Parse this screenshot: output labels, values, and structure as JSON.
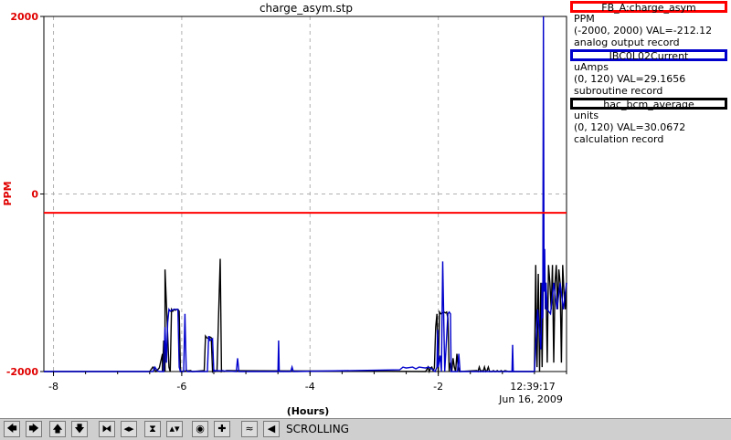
{
  "chart_data": {
    "type": "line",
    "title": "charge_asym.stp",
    "xlabel": "(Hours)",
    "ylabel": "PPM",
    "xlim": [
      -8.15,
      0
    ],
    "ylim": [
      -2000,
      2000
    ],
    "x_ticks": [
      -8,
      -6,
      -4,
      -2
    ],
    "x_tick_labels": [
      "-8",
      "-6",
      "-4",
      "-2"
    ],
    "y_ticks": [
      2000,
      0,
      -2000
    ],
    "y_tick_labels": [
      "2000",
      "0",
      "-2000"
    ],
    "end_time": "12:39:17",
    "end_date": "Jun 16, 2009",
    "grid": true,
    "series": [
      {
        "color": "#000000",
        "x": [
          -8.15,
          -6.5,
          -6.45,
          -6.4,
          -6.35,
          -6.3,
          -6.3,
          -6.28,
          -6.26,
          -6.26,
          -6.2,
          -6.18,
          -6.16,
          -6.14,
          -6.12,
          -6.1,
          -6.08,
          -6.06,
          -6.04,
          -6.02,
          -5.86,
          -5.84,
          -5.82,
          -5.65,
          -5.63,
          -5.61,
          -5.58,
          -5.56,
          -5.54,
          -5.52,
          -5.5,
          -5.48,
          -5.45,
          -5.4,
          -5.38,
          -5.36,
          -5.34,
          -5.3,
          -2.2,
          -2.18,
          -2.16,
          -2.14,
          -2.12,
          -2.1,
          -2.08,
          -2.06,
          -2.04,
          -2.02,
          -2.0,
          -1.98,
          -1.96,
          -1.93,
          -1.91,
          -1.89,
          -1.87,
          -1.85,
          -1.83,
          -1.81,
          -1.79,
          -1.77,
          -1.75,
          -1.73,
          -1.71,
          -1.69,
          -1.67,
          -1.4,
          -1.38,
          -1.36,
          -1.34,
          -1.32,
          -1.3,
          -1.28,
          -1.26,
          -1.24,
          -1.22,
          -1.2,
          -1.18,
          -1.16,
          -1.14,
          -1.12,
          -1.1,
          -1.08,
          -1.06,
          -1.04,
          -1.02,
          -1.0,
          -0.98,
          -0.96,
          -0.9,
          -0.5,
          -0.48,
          -0.46,
          -0.44,
          -0.42,
          -0.4,
          -0.38,
          -0.36,
          -0.34,
          -0.32,
          -0.3,
          -0.28,
          -0.26,
          -0.24,
          -0.22,
          -0.2,
          -0.18,
          -0.16,
          -0.14,
          -0.12,
          -0.1,
          -0.08,
          -0.06,
          -0.04,
          -0.02,
          0.0
        ],
        "y": [
          -2000,
          -2000,
          -1950,
          -2000,
          -1960,
          -1800,
          -2000,
          -1650,
          -2000,
          -850,
          -1950,
          -2000,
          -1300,
          -1320,
          -1300,
          -1310,
          -1300,
          -1300,
          -1320,
          -2000,
          -1990,
          -2000,
          -2000,
          -1990,
          -1600,
          -1620,
          -1630,
          -1610,
          -1620,
          -2000,
          -1980,
          -2000,
          -1990,
          -730,
          -2000,
          -1990,
          -2000,
          -1990,
          -2000,
          -1980,
          -1950,
          -2000,
          -1960,
          -1950,
          -1990,
          -1960,
          -1500,
          -1350,
          -2000,
          -1330,
          -1350,
          -1340,
          -1330,
          -1340,
          -1330,
          -1400,
          -2000,
          -1900,
          -2000,
          -1850,
          -1950,
          -2000,
          -1800,
          -1950,
          -2000,
          -1990,
          -2000,
          -1950,
          -2000,
          -1990,
          -2000,
          -1950,
          -2000,
          -1990,
          -1950,
          -2000,
          -2000,
          -2000,
          -1990,
          -2000,
          -2000,
          -1990,
          -2000,
          -2000,
          -1990,
          -2000,
          -2000,
          -1990,
          -2000,
          -2000,
          -800,
          -1950,
          -900,
          -2000,
          -1000,
          -1950,
          -800,
          -1100,
          -1000,
          -1900,
          -800,
          -1000,
          -1300,
          -800,
          -1900,
          -1000,
          -800,
          -1300,
          -850,
          -1000,
          -1900,
          -800,
          -1100,
          -1300,
          -1000
        ]
      },
      {
        "color": "#0000cc",
        "x": [
          -8.15,
          -6.45,
          -6.42,
          -6.38,
          -6.35,
          -6.28,
          -6.26,
          -6.24,
          -6.22,
          -6.2,
          -6.18,
          -6.16,
          -6.12,
          -6.06,
          -6.04,
          -6.02,
          -5.97,
          -5.95,
          -5.93,
          -5.91,
          -5.6,
          -5.58,
          -5.56,
          -5.52,
          -5.5,
          -5.48,
          -5.15,
          -5.13,
          -5.11,
          -4.5,
          -4.49,
          -4.48,
          -4.3,
          -4.28,
          -4.26,
          -2.6,
          -2.55,
          -2.5,
          -2.4,
          -2.35,
          -2.3,
          -2.2,
          -2.15,
          -2.1,
          -2.05,
          -2.02,
          -2.01,
          -2.0,
          -1.97,
          -1.95,
          -1.93,
          -1.9,
          -1.85,
          -1.83,
          -1.81,
          -1.8,
          -1.7,
          -1.68,
          -1.66,
          -0.85,
          -0.84,
          -0.83,
          -0.5,
          -0.45,
          -0.4,
          -0.38,
          -0.37,
          -0.36,
          -0.35,
          -0.34,
          -0.33,
          -0.32,
          -0.3,
          -0.25,
          -0.2,
          -0.15,
          -0.1,
          -0.05,
          0.0
        ],
        "y": [
          -2000,
          -2000,
          -1950,
          -1990,
          -2000,
          -2000,
          -1500,
          -1900,
          -1450,
          -1300,
          -1320,
          -1310,
          -1300,
          -1300,
          -1950,
          -2000,
          -2000,
          -1350,
          -1980,
          -2000,
          -2000,
          -1600,
          -1650,
          -1630,
          -2000,
          -1990,
          -2000,
          -1850,
          -2000,
          -2000,
          -1650,
          -2000,
          -2000,
          -1950,
          -2000,
          -1980,
          -1950,
          -1960,
          -1950,
          -1970,
          -1950,
          -1960,
          -1950,
          -1970,
          -2000,
          -1950,
          -1530,
          -1950,
          -1820,
          -2000,
          -760,
          -2000,
          -1350,
          -1330,
          -1350,
          -2000,
          -2000,
          -1800,
          -2000,
          -2000,
          -1700,
          -2000,
          -2000,
          -1300,
          -1750,
          -1000,
          -1400,
          2000,
          -1100,
          -620,
          -1300,
          -1000,
          -1300,
          -1350,
          -1000,
          -1300,
          -1000,
          -1300,
          -1000
        ]
      },
      {
        "color": "#ff0000",
        "x": [
          -8.15,
          0
        ],
        "y": [
          -212.12,
          -212.12
        ]
      }
    ]
  },
  "legend": [
    {
      "border_color": "#ff0000",
      "name": "FB_A:charge_asym",
      "units": "PPM",
      "range_val": "(-2000, 2000) VAL=-212.12",
      "record_type": "analog output record"
    },
    {
      "border_color": "#0000cc",
      "name": "IBC0L02Current",
      "units": "uAmps",
      "range_val": "(0, 120) VAL=29.1656",
      "record_type": "subroutine record"
    },
    {
      "border_color": "#000000",
      "name": "hac_bcm_average",
      "units": "units",
      "range_val": "(0, 120) VAL=30.0672",
      "record_type": "calculation record"
    }
  ],
  "toolbar": {
    "status": "SCROLLING",
    "buttons": [
      {
        "icon": "arrow-left-icon",
        "glyph": "🡄"
      },
      {
        "icon": "arrow-right-icon",
        "glyph": "🡆"
      },
      {
        "icon": "arrow-up-icon",
        "glyph": "🡅"
      },
      {
        "icon": "arrow-down-icon",
        "glyph": "🡇"
      },
      {
        "icon": "zoom-in-horizontal-icon",
        "glyph": "⧓"
      },
      {
        "icon": "zoom-out-horizontal-icon",
        "glyph": "◂▸"
      },
      {
        "icon": "zoom-in-vertical-icon",
        "glyph": "⧗"
      },
      {
        "icon": "zoom-out-vertical-icon",
        "glyph": "▴▾"
      },
      {
        "icon": "center-icon",
        "glyph": "◉"
      },
      {
        "icon": "crosshair-icon",
        "glyph": "✚"
      },
      {
        "icon": "autoscale-icon",
        "glyph": "≈"
      },
      {
        "icon": "scroll-left-icon",
        "glyph": "◀"
      }
    ]
  }
}
